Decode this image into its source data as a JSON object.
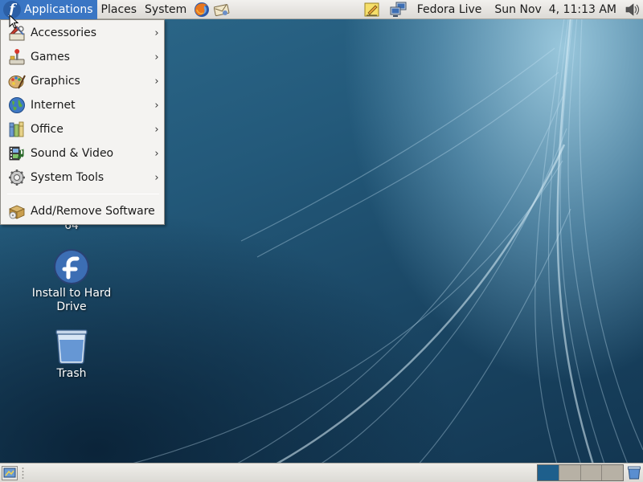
{
  "top_panel": {
    "menus": {
      "applications": "Applications",
      "places": "Places",
      "system": "System"
    },
    "launchers": [
      "firefox-icon",
      "mail-icon"
    ],
    "notes_icon": "notes-icon",
    "network_icon": "network-icon",
    "user": "Fedora Live",
    "clock": "Sun Nov  4, 11:13 AM",
    "volume_icon": "volume-icon"
  },
  "applications_menu": {
    "items": [
      {
        "label": "Accessories",
        "icon": "accessories-icon",
        "submenu": true
      },
      {
        "label": "Games",
        "icon": "games-icon",
        "submenu": true
      },
      {
        "label": "Graphics",
        "icon": "graphics-icon",
        "submenu": true
      },
      {
        "label": "Internet",
        "icon": "internet-icon",
        "submenu": true
      },
      {
        "label": "Office",
        "icon": "office-icon",
        "submenu": true
      },
      {
        "label": "Sound & Video",
        "icon": "sound-video-icon",
        "submenu": true
      },
      {
        "label": "System Tools",
        "icon": "system-tools-icon",
        "submenu": true
      }
    ],
    "footer_item": {
      "label": "Add/Remove Software",
      "icon": "package-icon"
    },
    "arrow_glyph": "›"
  },
  "desktop": {
    "icons": [
      {
        "label": "64"
      },
      {
        "label": "Install to Hard Drive"
      },
      {
        "label": "Trash"
      }
    ]
  },
  "bottom_panel": {
    "workspaces": 4,
    "active_workspace": 1
  },
  "colors": {
    "menu_highlight": "#3a76c4",
    "fedora_blue": "#2b5fa6",
    "active_workspace": "#1e5f8c",
    "inactive_workspace": "#b7b1a5"
  }
}
